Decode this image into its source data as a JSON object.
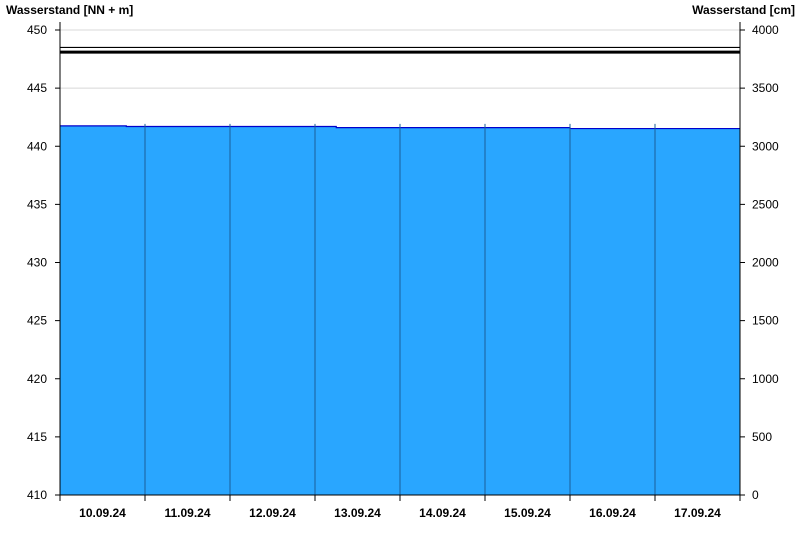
{
  "chart_data": {
    "type": "area",
    "left_axis_label": "Wasserstand [NN + m]",
    "right_axis_label": "Wasserstand [cm]",
    "ylim_left": [
      410,
      450
    ],
    "ylim_right": [
      0,
      4000
    ],
    "yticks_left": [
      410,
      415,
      420,
      425,
      430,
      435,
      440,
      445,
      450
    ],
    "yticks_right": [
      0,
      500,
      1000,
      1500,
      2000,
      2500,
      3000,
      3500,
      4000
    ],
    "x_categories": [
      "10.09.24",
      "11.09.24",
      "12.09.24",
      "13.09.24",
      "14.09.24",
      "15.09.24",
      "16.09.24",
      "17.09.24"
    ],
    "series": [
      {
        "x": [
          0,
          0.78,
          0.78,
          3.25,
          3.25,
          6.0,
          6.0,
          8.0
        ],
        "values": [
          441.75,
          441.75,
          441.7,
          441.7,
          441.6,
          441.6,
          441.52,
          441.52
        ]
      }
    ],
    "reference_lines": [
      448.5,
      448.1
    ],
    "fill_color": "#29a6ff",
    "line_color": "#0000cc",
    "grid": true
  }
}
